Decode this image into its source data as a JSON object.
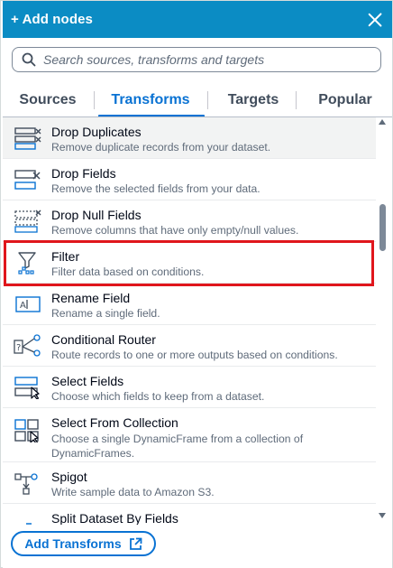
{
  "header": {
    "title": "+ Add nodes"
  },
  "search": {
    "placeholder": "Search sources, transforms and targets"
  },
  "tabs": [
    {
      "label": "Sources",
      "active": false
    },
    {
      "label": "Transforms",
      "active": true
    },
    {
      "label": "Targets",
      "active": false
    },
    {
      "label": "Popular",
      "active": false
    }
  ],
  "nodes": [
    {
      "name": "Drop Duplicates",
      "description": "Remove duplicate records from your dataset.",
      "icon": "drop-duplicates-icon",
      "selected": true
    },
    {
      "name": "Drop Fields",
      "description": "Remove the selected fields from your data.",
      "icon": "drop-fields-icon"
    },
    {
      "name": "Drop Null Fields",
      "description": "Remove columns that have only empty/null values.",
      "icon": "drop-null-fields-icon"
    },
    {
      "name": "Filter",
      "description": "Filter data based on conditions.",
      "icon": "filter-icon",
      "highlighted": true
    },
    {
      "name": "Rename Field",
      "description": "Rename a single field.",
      "icon": "rename-field-icon"
    },
    {
      "name": "Conditional Router",
      "description": "Route records to one or more outputs based on conditions.",
      "icon": "conditional-router-icon"
    },
    {
      "name": "Select Fields",
      "description": "Choose which fields to keep from a dataset.",
      "icon": "select-fields-icon"
    },
    {
      "name": "Select From Collection",
      "description": "Choose a single DynamicFrame from a collection of DynamicFrames.",
      "icon": "select-from-collection-icon"
    },
    {
      "name": "Spigot",
      "description": "Write sample data to Amazon S3.",
      "icon": "spigot-icon"
    },
    {
      "name": "Split Dataset By Fields",
      "description": "",
      "icon": "split-dataset-icon"
    }
  ],
  "footer": {
    "add_button_label": "Add Transforms",
    "add_button_icon": "external-link-icon"
  },
  "colors": {
    "header_bg": "#0b8cc4",
    "accent": "#0972d3",
    "highlight": "#e0161c"
  }
}
